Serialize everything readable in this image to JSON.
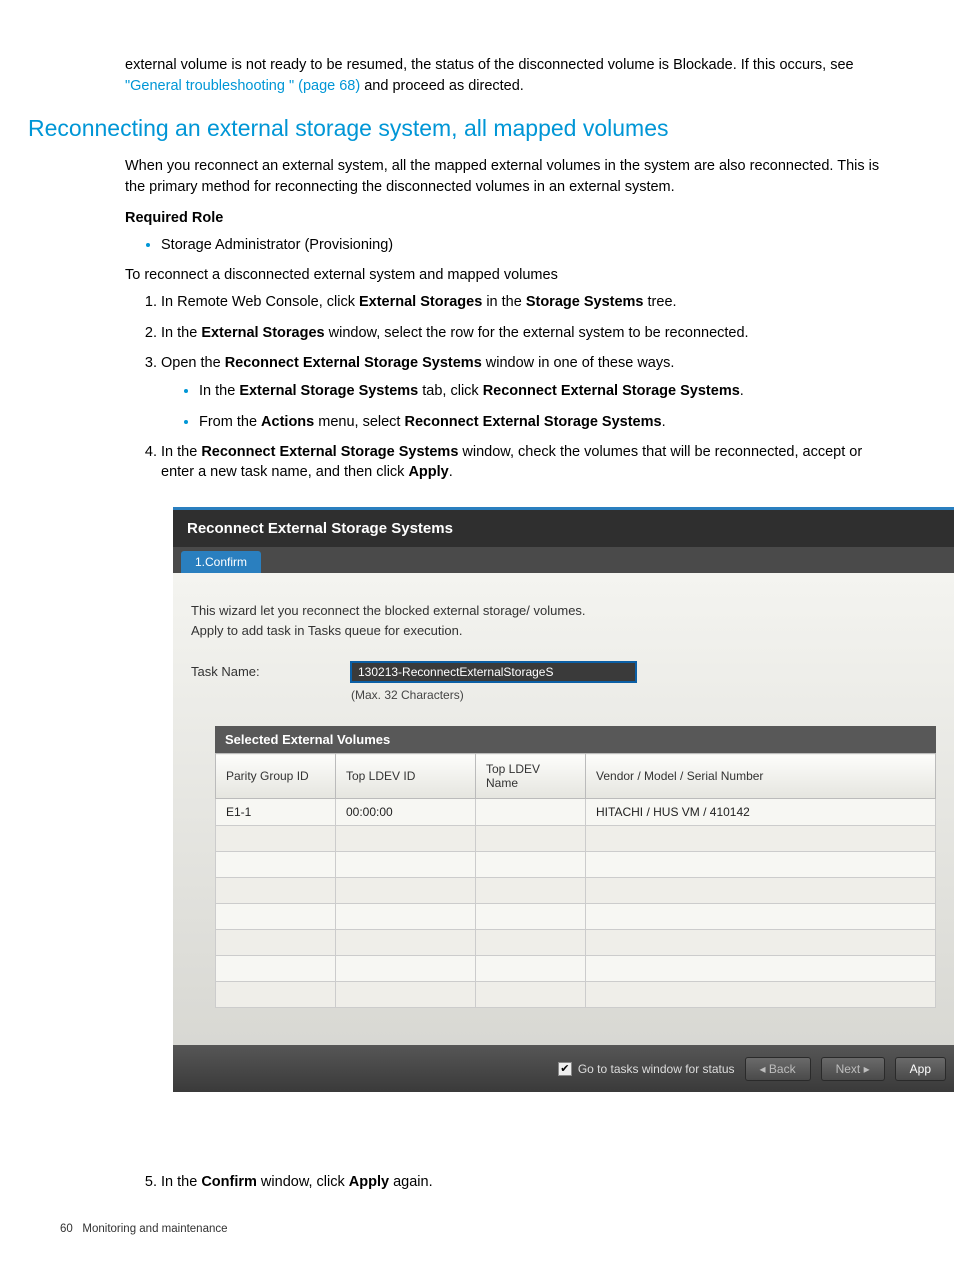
{
  "intro": {
    "line1_pre": "external volume is not ready to be resumed, the status of the disconnected volume is Blockade. If this occurs, see ",
    "link": "\"General troubleshooting \" (page 68)",
    "line1_post": " and proceed as directed."
  },
  "section_title": "Reconnecting an external storage system, all mapped volumes",
  "sec_intro": "When you reconnect an external system, all the mapped external volumes in the system are also reconnected. This is the primary method for reconnecting the disconnected volumes in an external system.",
  "required_role_label": "Required Role",
  "role_item": "Storage Administrator (Provisioning)",
  "proc_intro": "To reconnect a disconnected external system and mapped volumes",
  "steps": {
    "s1_a": "In Remote Web Console, click ",
    "s1_b": "External Storages",
    "s1_c": " in the ",
    "s1_d": "Storage Systems",
    "s1_e": " tree.",
    "s2_a": "In the ",
    "s2_b": "External Storages",
    "s2_c": " window, select the row for the external system to be reconnected.",
    "s3_a": "Open the ",
    "s3_b": "Reconnect External Storage Systems",
    "s3_c": " window in one of these ways.",
    "s3_sub1_a": "In the ",
    "s3_sub1_b": "External Storage Systems",
    "s3_sub1_c": " tab, click ",
    "s3_sub1_d": "Reconnect External Storage Systems",
    "s3_sub1_e": ".",
    "s3_sub2_a": "From the ",
    "s3_sub2_b": "Actions",
    "s3_sub2_c": " menu, select  ",
    "s3_sub2_d": "Reconnect External Storage Systems",
    "s3_sub2_e": ".",
    "s4_a": "In the ",
    "s4_b": "Reconnect External Storage Systems",
    "s4_c": " window, check the volumes that will be reconnected, accept or enter a new task name, and then click ",
    "s4_d": "Apply",
    "s4_e": ".",
    "s5_a": "In the ",
    "s5_b": "Confirm",
    "s5_c": " window, click ",
    "s5_d": "Apply",
    "s5_e": " again."
  },
  "dialog": {
    "title": "Reconnect External Storage Systems",
    "tab": "1.Confirm",
    "desc1": "This wizard let you reconnect the blocked external storage/ volumes.",
    "desc2": "Apply to add task in Tasks queue for execution.",
    "task_label": "Task Name:",
    "task_value": "130213-ReconnectExternalStorageS",
    "hint": "(Max. 32 Characters)",
    "table_title": "Selected External Volumes",
    "cols": {
      "c1": "Parity Group ID",
      "c2": "Top LDEV ID",
      "c3": "Top LDEV Name",
      "c4": "Vendor / Model / Serial Number"
    },
    "row": {
      "c1": "E1-1",
      "c2": "00:00:00",
      "c3": "",
      "c4": "HITACHI / HUS VM / 410142"
    },
    "footer": {
      "chk_label": "Go to tasks window for status",
      "back": "Back",
      "next": "Next",
      "apply": "App"
    }
  },
  "pagefoot": {
    "num": "60",
    "text": "Monitoring and maintenance"
  }
}
